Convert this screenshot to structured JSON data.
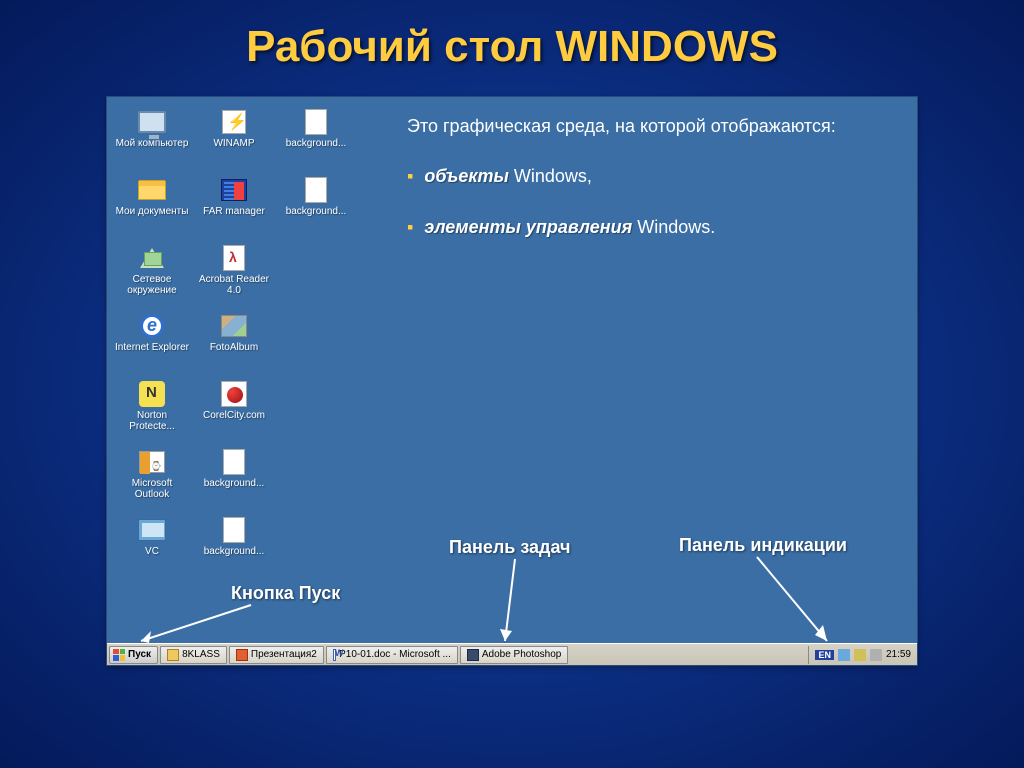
{
  "title": "Рабочий стол WINDOWS",
  "description": {
    "intro": "Это графическая среда, на которой отображаются:",
    "bullet1_emph": "объекты",
    "bullet1_rest": " Windows,",
    "bullet2_emph": "элементы управления",
    "bullet2_rest": " Windows."
  },
  "callouts": {
    "start": "Кнопка Пуск",
    "taskbar": "Панель задач",
    "tray": "Панель индикации"
  },
  "icons": [
    {
      "label": "Мой компьютер",
      "glyph": "monitor"
    },
    {
      "label": "WINAMP",
      "glyph": "winamp"
    },
    {
      "label": "background...",
      "glyph": "paint"
    },
    {
      "label": "Мои документы",
      "glyph": "folder-docs"
    },
    {
      "label": "FAR manager",
      "glyph": "far"
    },
    {
      "label": "background...",
      "glyph": "paint"
    },
    {
      "label": "Сетевое окружение",
      "glyph": "network"
    },
    {
      "label": "Acrobat Reader 4.0",
      "glyph": "pdf"
    },
    {
      "label": "",
      "glyph": ""
    },
    {
      "label": "Internet Explorer",
      "glyph": "ie"
    },
    {
      "label": "FotoAlbum",
      "glyph": "foto"
    },
    {
      "label": "",
      "glyph": ""
    },
    {
      "label": "Norton Protecte...",
      "glyph": "nav"
    },
    {
      "label": "CorelCity.com",
      "glyph": "corel"
    },
    {
      "label": "",
      "glyph": ""
    },
    {
      "label": "Microsoft Outlook",
      "glyph": "outlook"
    },
    {
      "label": "background...",
      "glyph": "paint"
    },
    {
      "label": "",
      "glyph": ""
    },
    {
      "label": "VC",
      "glyph": "vc"
    },
    {
      "label": "background...",
      "glyph": "paint"
    }
  ],
  "taskbar": {
    "start": "Пуск",
    "items": [
      {
        "label": "8KLASS",
        "iconClass": "i-folder"
      },
      {
        "label": "Презентация2",
        "iconClass": "i-ppt"
      },
      {
        "label": "P10-01.doc - Microsoft ...",
        "iconClass": "i-doc"
      },
      {
        "label": "Adobe Photoshop",
        "iconClass": "i-ps"
      }
    ],
    "lang": "EN",
    "clock": "21:59"
  }
}
